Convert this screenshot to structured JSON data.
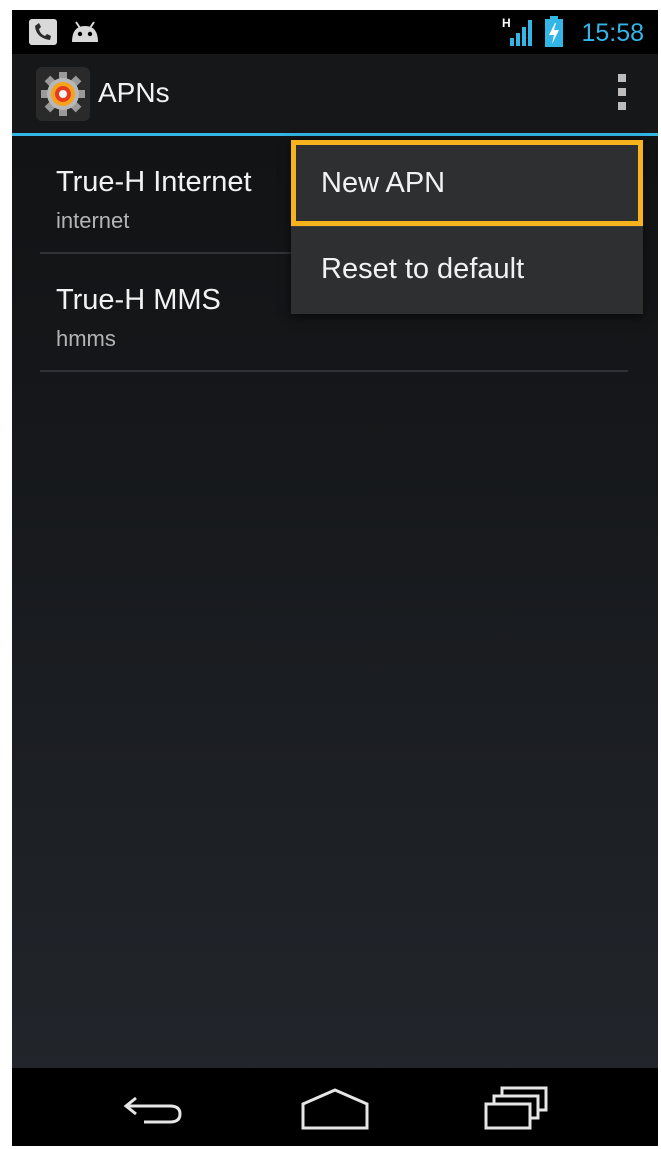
{
  "status_bar": {
    "time": "15:58",
    "left_icons": [
      "phone-signal-app-icon",
      "android-icon"
    ],
    "right_icons": [
      "signal-h-icon",
      "battery-charging-icon"
    ],
    "network_type": "H"
  },
  "action_bar": {
    "title": "APNs",
    "app_icon": "settings-gear-icon",
    "overflow_icon": "more-vertical-icon"
  },
  "apn_list": {
    "items": [
      {
        "name": "True-H Internet",
        "value": "internet"
      },
      {
        "name": "True-H MMS",
        "value": "hmms"
      }
    ]
  },
  "overflow_menu": {
    "items": [
      {
        "label": "New APN",
        "highlighted": true
      },
      {
        "label": "Reset to default",
        "highlighted": false
      }
    ]
  },
  "nav_bar": {
    "buttons": [
      "back-icon",
      "home-icon",
      "recents-icon"
    ]
  },
  "colors": {
    "accent": "#33b5e5",
    "highlight_border": "#f7b31c",
    "text_primary": "#f2f2f2",
    "text_secondary": "#b4b4b4"
  }
}
